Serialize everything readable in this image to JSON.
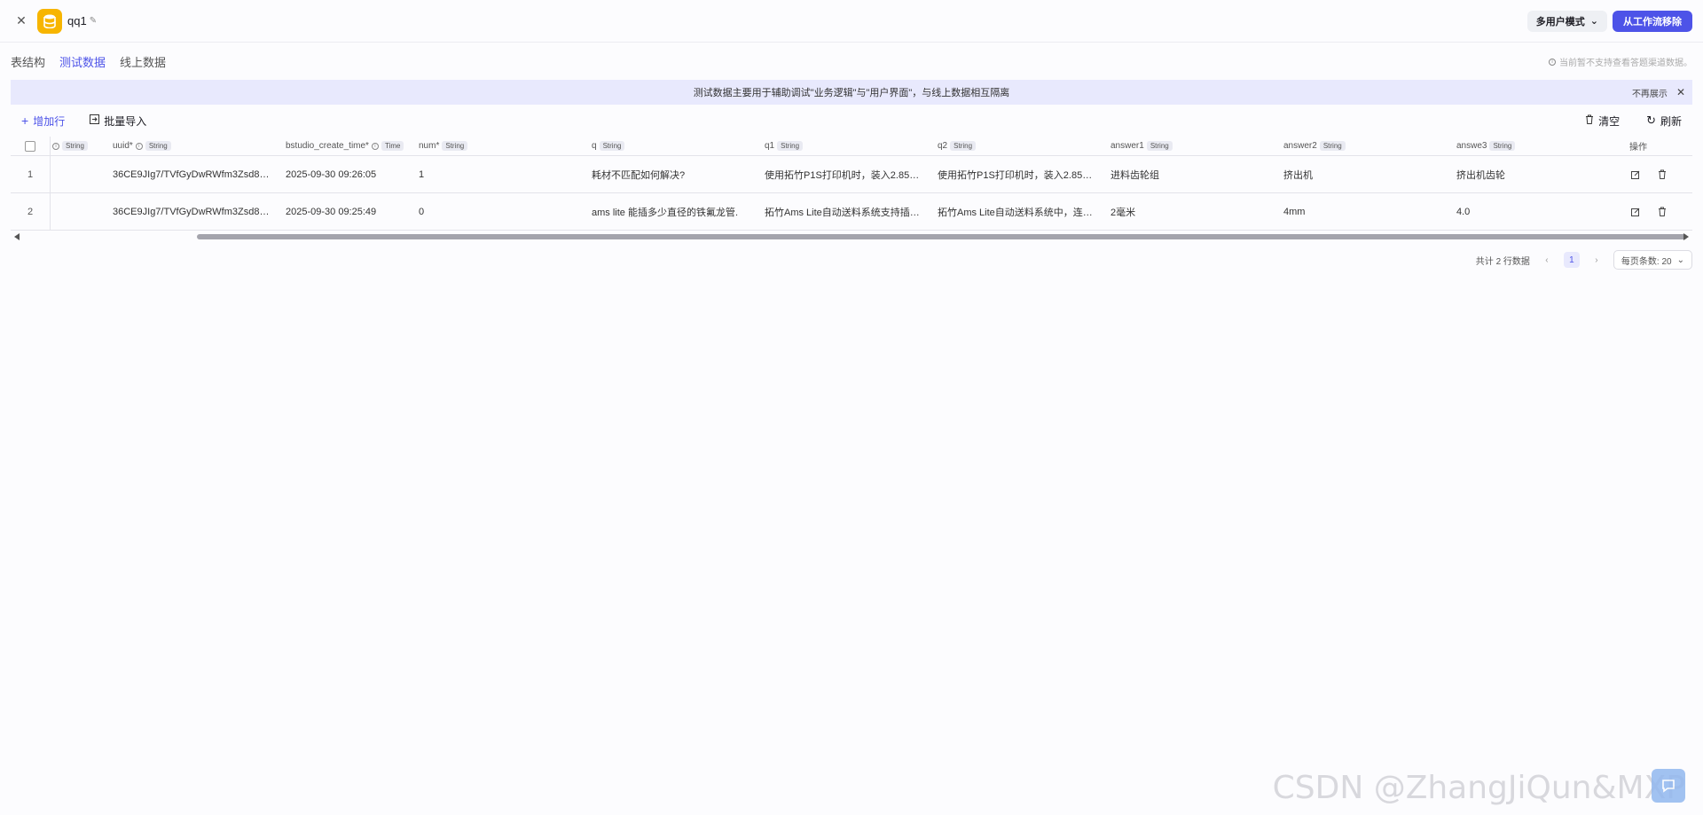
{
  "header": {
    "title": "qq1",
    "mode_label": "多用户模式",
    "remove_label": "从工作流移除"
  },
  "tabs": [
    {
      "label": "表结构",
      "active": false
    },
    {
      "label": "测试数据",
      "active": true
    },
    {
      "label": "线上数据",
      "active": false
    }
  ],
  "tab_note": "当前暂不支持查看答题渠道数据。",
  "banner": {
    "text": "测试数据主要用于辅助调试\"业务逻辑\"与\"用户界面\"，与线上数据相互隔离",
    "hide_label": "不再展示"
  },
  "toolbar": {
    "add_row": "增加行",
    "batch_import": "批量导入",
    "clear": "清空",
    "refresh": "刷新"
  },
  "table": {
    "columns": [
      {
        "name": "",
        "type": "String"
      },
      {
        "name": "uuid*",
        "type": "String"
      },
      {
        "name": "bstudio_create_time*",
        "type": "Time"
      },
      {
        "name": "num*",
        "type": "String"
      },
      {
        "name": "q",
        "type": "String"
      },
      {
        "name": "q1",
        "type": "String"
      },
      {
        "name": "q2",
        "type": "String"
      },
      {
        "name": "answer1",
        "type": "String"
      },
      {
        "name": "answer2",
        "type": "String"
      },
      {
        "name": "answe3",
        "type": "String"
      }
    ],
    "op_header": "操作",
    "rows": [
      {
        "index": "1",
        "uuid": "36CE9JIg7/TVfGyDwRWfm3Zsd8A…",
        "time": "2025-09-30 09:26:05",
        "num": "1",
        "q": "耗材不匹配如何解决?",
        "q1": "使用拓竹P1S打印机时，装入2.85m…",
        "q2": "使用拓竹P1S打印机时，装入2.85m…",
        "answer1": "进料齿轮组",
        "answer2": "挤出机",
        "answe3": "挤出机齿轮"
      },
      {
        "index": "2",
        "uuid": "36CE9JIg7/TVfGyDwRWfm3Zsd8A…",
        "time": "2025-09-30 09:25:49",
        "num": "0",
        "q": "ams lite 能插多少直径的铁氟龙管.",
        "q1": "拓竹Ams Lite自动送料系统支持插入…",
        "q2": "拓竹Ams Lite自动送料系统中，连接…",
        "answer1": "2毫米",
        "answer2": "4mm",
        "answe3": "4.0"
      }
    ]
  },
  "pager": {
    "total": "共计 2 行数据",
    "current": "1",
    "page_size": "每页条数: 20"
  },
  "watermark": "CSDN @ZhangJiQun&MXP"
}
